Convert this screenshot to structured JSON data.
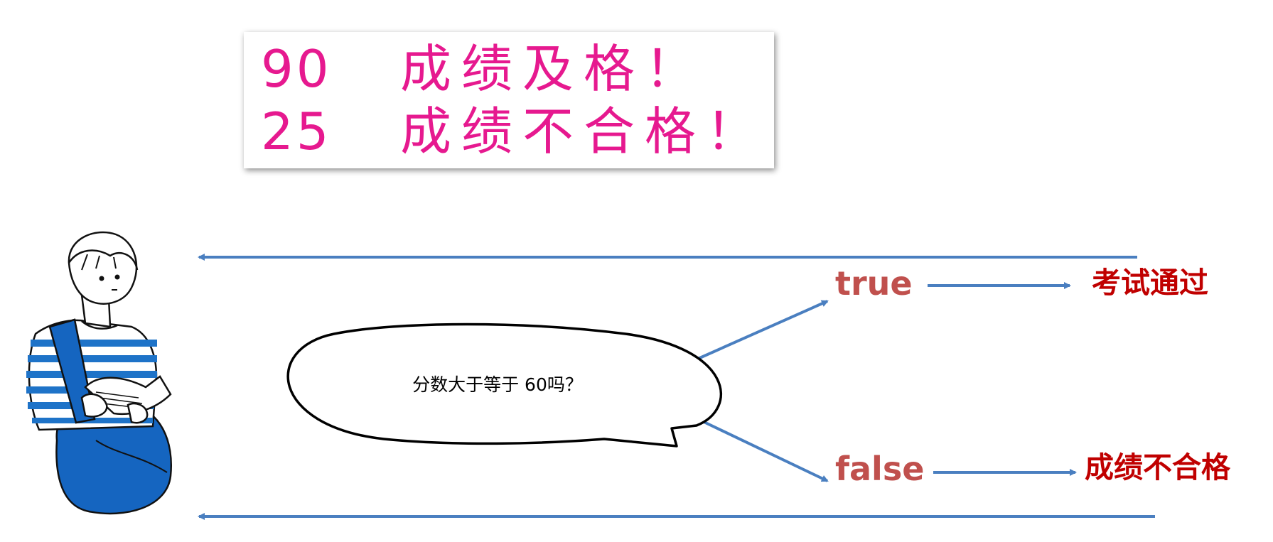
{
  "card": {
    "line1_score": "90",
    "line1_text": "成绩及格！",
    "line2_score": "25",
    "line2_text": "成绩不合格！",
    "text_color": "#e6198f"
  },
  "question": "分数大于等于 60吗？",
  "branch_true": {
    "label": "true",
    "result": "考试通过"
  },
  "branch_false": {
    "label": "false",
    "result": "成绩不合格"
  },
  "colors": {
    "arrow": "#4a7fc0",
    "branch_label": "#c0504d",
    "result": "#c00000",
    "shirt_stripe": "#1e73c8",
    "bag": "#1565c0"
  }
}
